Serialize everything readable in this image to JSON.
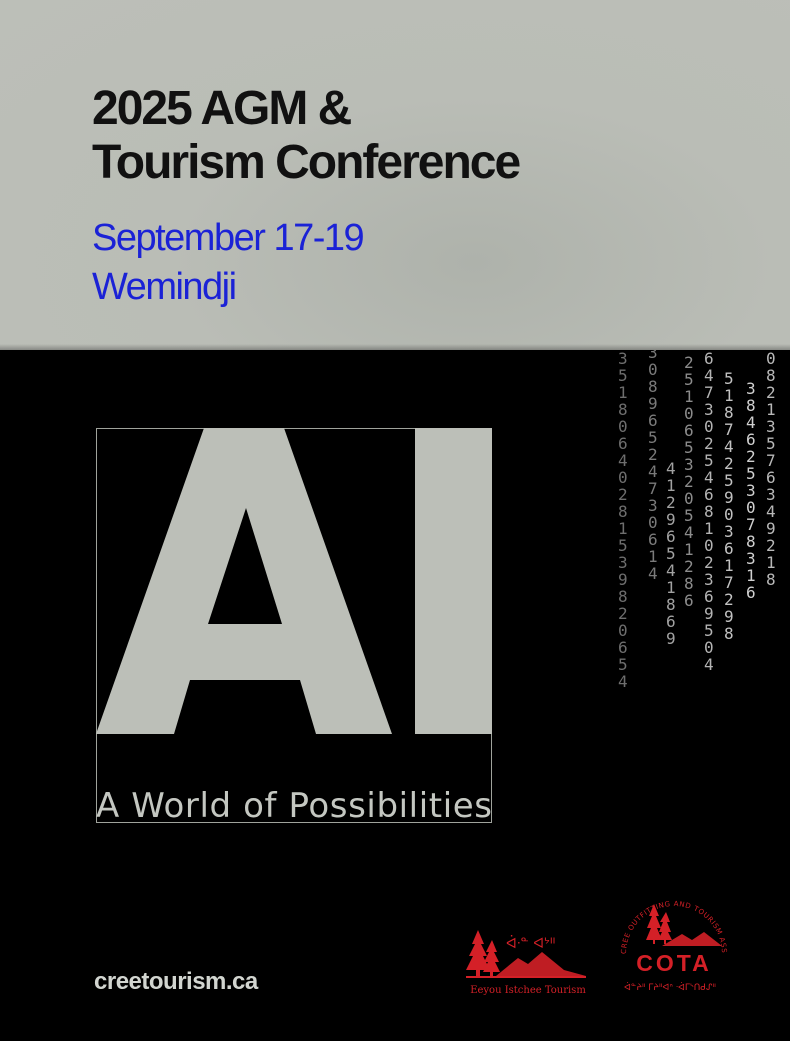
{
  "event": {
    "title_line1": "2025 AGM &",
    "title_line2": "Tourism Conference",
    "dates": "September 17-19",
    "location": "Wemindji"
  },
  "theme": {
    "headline": "AI",
    "tagline": "A World of Possibilities"
  },
  "footer": {
    "website": "creetourism.ca"
  },
  "logos": {
    "eeyou_istchee": "Eeyou Istchee Tourism",
    "cota": "COTA",
    "cota_ring": "CREE OUTFITTING AND TOURISM ASSOCIATION"
  },
  "colors": {
    "top_panel": "#bcbfb8",
    "accent_blue": "#1b22d6",
    "logo_red": "#d42027",
    "background": "#000000"
  }
}
